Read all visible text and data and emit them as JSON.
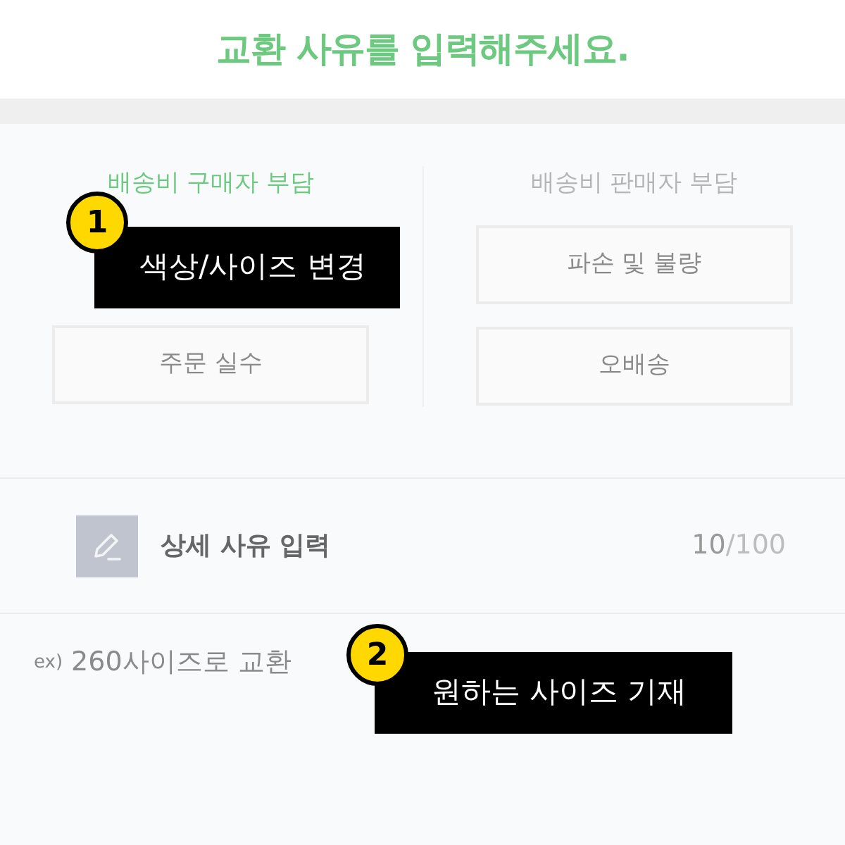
{
  "title": "교환 사유를 입력해주세요.",
  "columns": [
    {
      "header": "배송비 구매자 부담",
      "selected": true,
      "options": [
        "주문 실수"
      ]
    },
    {
      "header": "배송비 판매자 부담",
      "selected": false,
      "options": [
        "파손 및 불량",
        "오배송"
      ]
    }
  ],
  "detail": {
    "label": "상세 사유 입력",
    "count": "10",
    "max": "/100",
    "prefix": "ex)",
    "placeholder": "260사이즈로 교환"
  },
  "callouts": [
    {
      "number": "1",
      "text": "색상/사이즈 변경"
    },
    {
      "number": "2",
      "text": "원하는 사이즈 기재"
    }
  ]
}
